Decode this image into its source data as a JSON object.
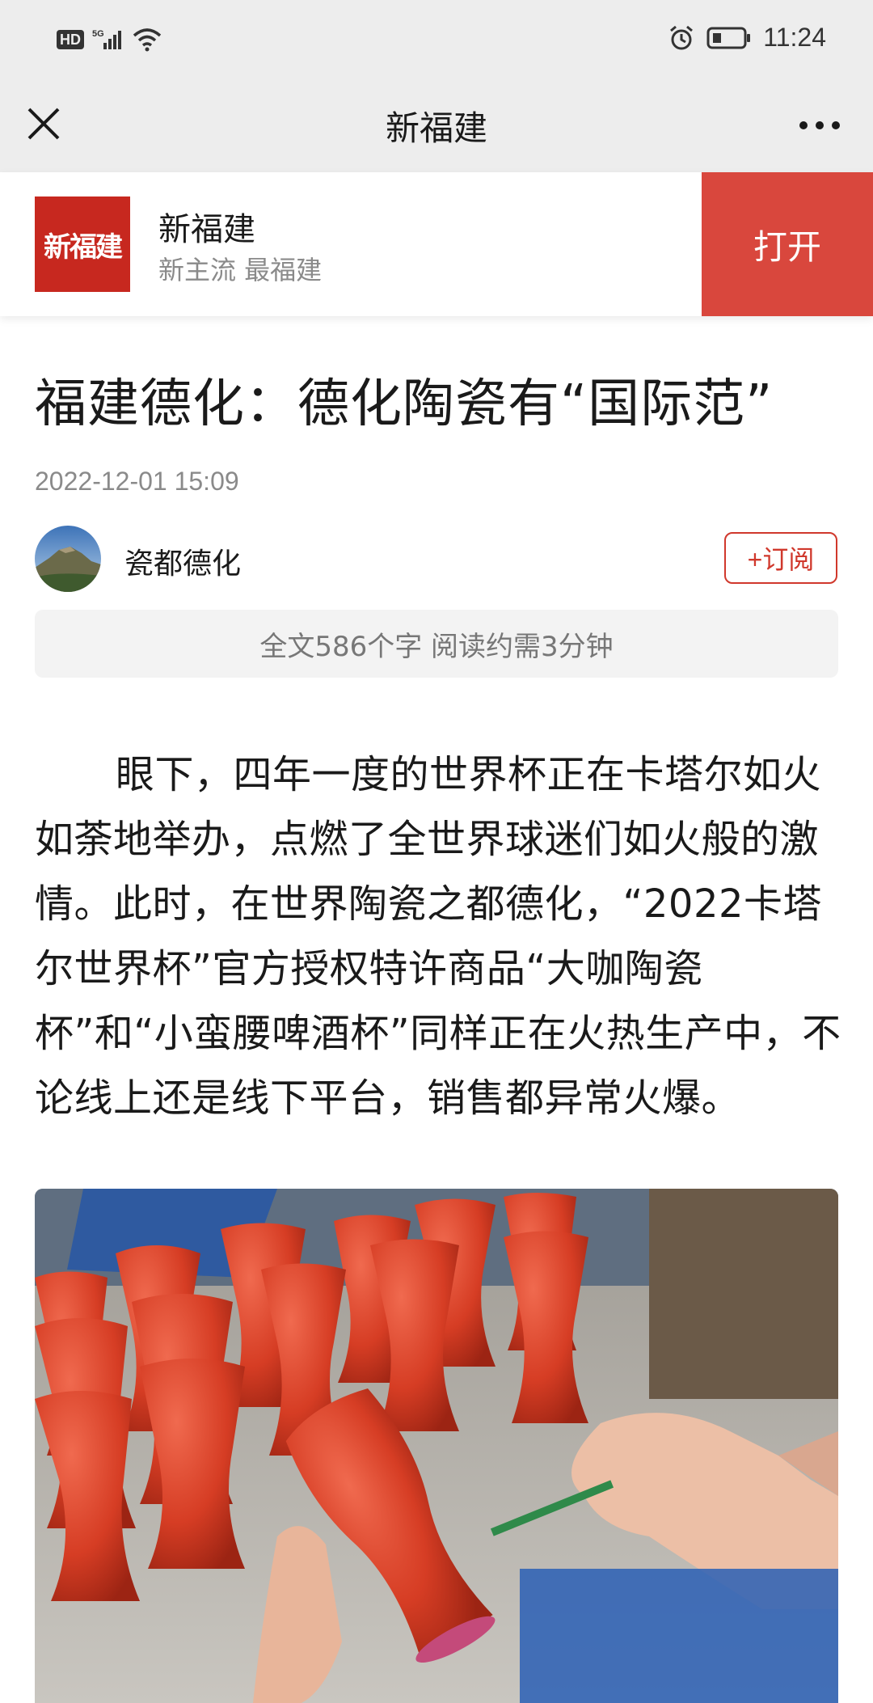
{
  "status_bar": {
    "time": "11:24",
    "hd_label": "HD",
    "network": "5G"
  },
  "title_bar": {
    "title": "新福建"
  },
  "app_banner": {
    "app_name": "新福建",
    "slogan": "新主流 最福建",
    "open_label": "打开",
    "logo_text": "新福建"
  },
  "article": {
    "title": "福建德化：德化陶瓷有“国际范”",
    "date": "2022-12-01 15:09",
    "author": "瓷都德化",
    "subscribe_label": "+订阅",
    "read_info": "全文586个字 阅读约需3分钟",
    "paragraph": "眼下，四年一度的世界杯正在卡塔尔如火如荼地举办，点燃了全世界球迷们如火般的激情。此时，在世界陶瓷之都德化，“2022卡塔尔世界杯”官方授权特许商品“大咖陶瓷杯”和“小蛮腰啤酒杯”同样正在火热生产中，不论线上还是线下平台，销售都异常火爆。"
  },
  "colors": {
    "accent_red": "#d9473d",
    "logo_red": "#c7281f",
    "header_gray": "#ededed"
  }
}
